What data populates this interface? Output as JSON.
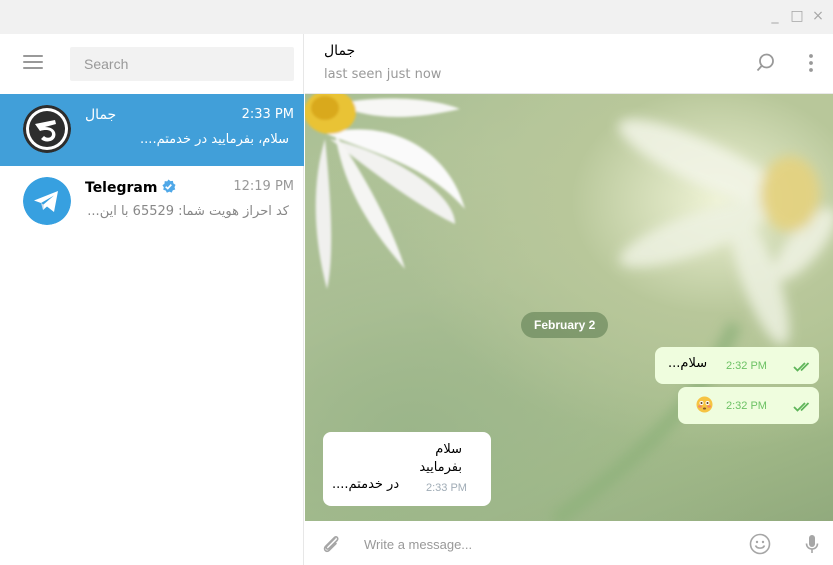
{
  "window": {
    "minimize": "_",
    "maximize": "□",
    "close": "×"
  },
  "sidebar": {
    "search_placeholder": "Search",
    "chats": [
      {
        "name": "جمال",
        "time": "2:33 PM",
        "preview": "سلام، بفرمایید در خدمتم....",
        "active": true
      },
      {
        "name": "Telegram",
        "time": "12:19 PM",
        "preview": "کد احراز هویت شما: 65529 با این...",
        "verified": true
      }
    ]
  },
  "header": {
    "name": "جمال",
    "status": "last seen just now"
  },
  "conversation": {
    "date": "February 2",
    "messages": [
      {
        "direction": "out",
        "text": "سلام...",
        "time": "2:32 PM",
        "read": true
      },
      {
        "direction": "out",
        "emoji": "😳",
        "time": "2:32 PM",
        "read": true
      },
      {
        "direction": "in",
        "lines": [
          "سلام",
          "بفرمایید",
          "در خدمتم...."
        ],
        "time": "2:33 PM"
      }
    ]
  },
  "composer": {
    "placeholder": "Write a message..."
  },
  "colors": {
    "accent": "#419fd9",
    "outgoing_bubble": "#effdde",
    "read_check": "#5fb55a",
    "date_pill": "#6f8f62"
  },
  "icons": [
    "menu-icon",
    "search-icon",
    "more-vertical-icon",
    "attach-icon",
    "emoji-icon",
    "microphone-icon",
    "verified-icon",
    "double-check-icon"
  ]
}
